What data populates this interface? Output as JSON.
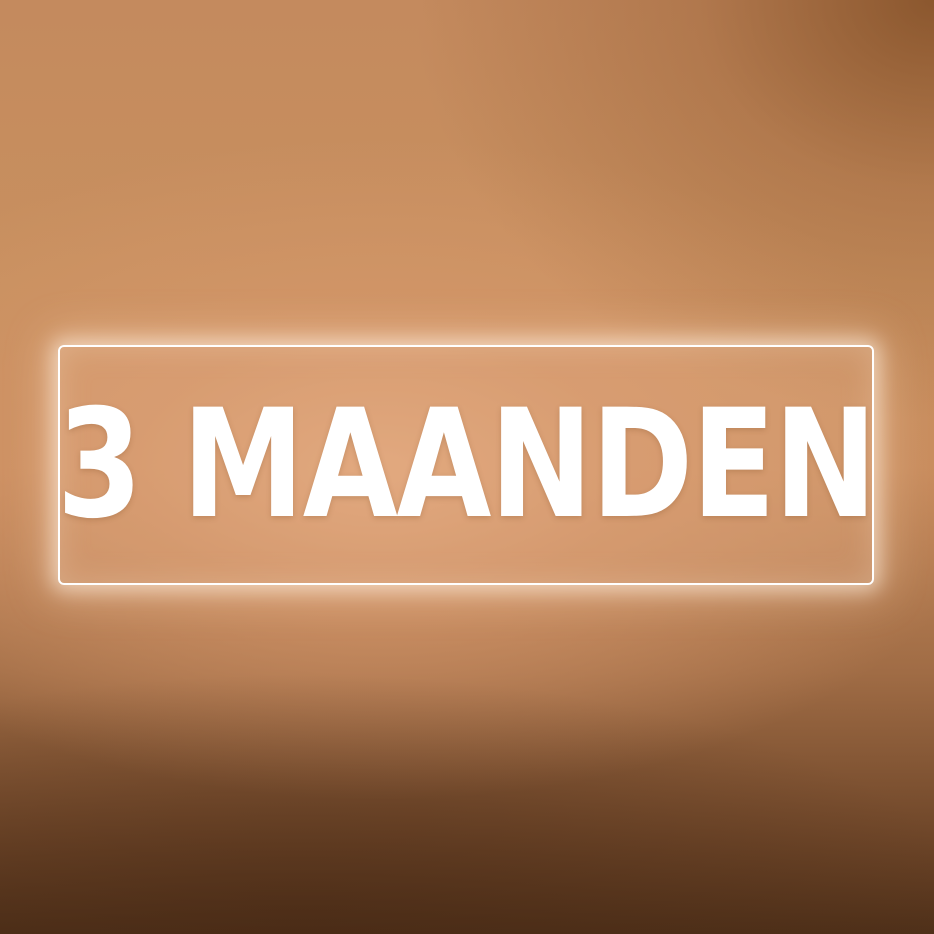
{
  "label": {
    "text": "3 MAANDEN"
  },
  "colors": {
    "text": "#ffffff",
    "border": "#ffffff",
    "background_light": "#d8a07a",
    "background_dark": "#4f3019"
  }
}
